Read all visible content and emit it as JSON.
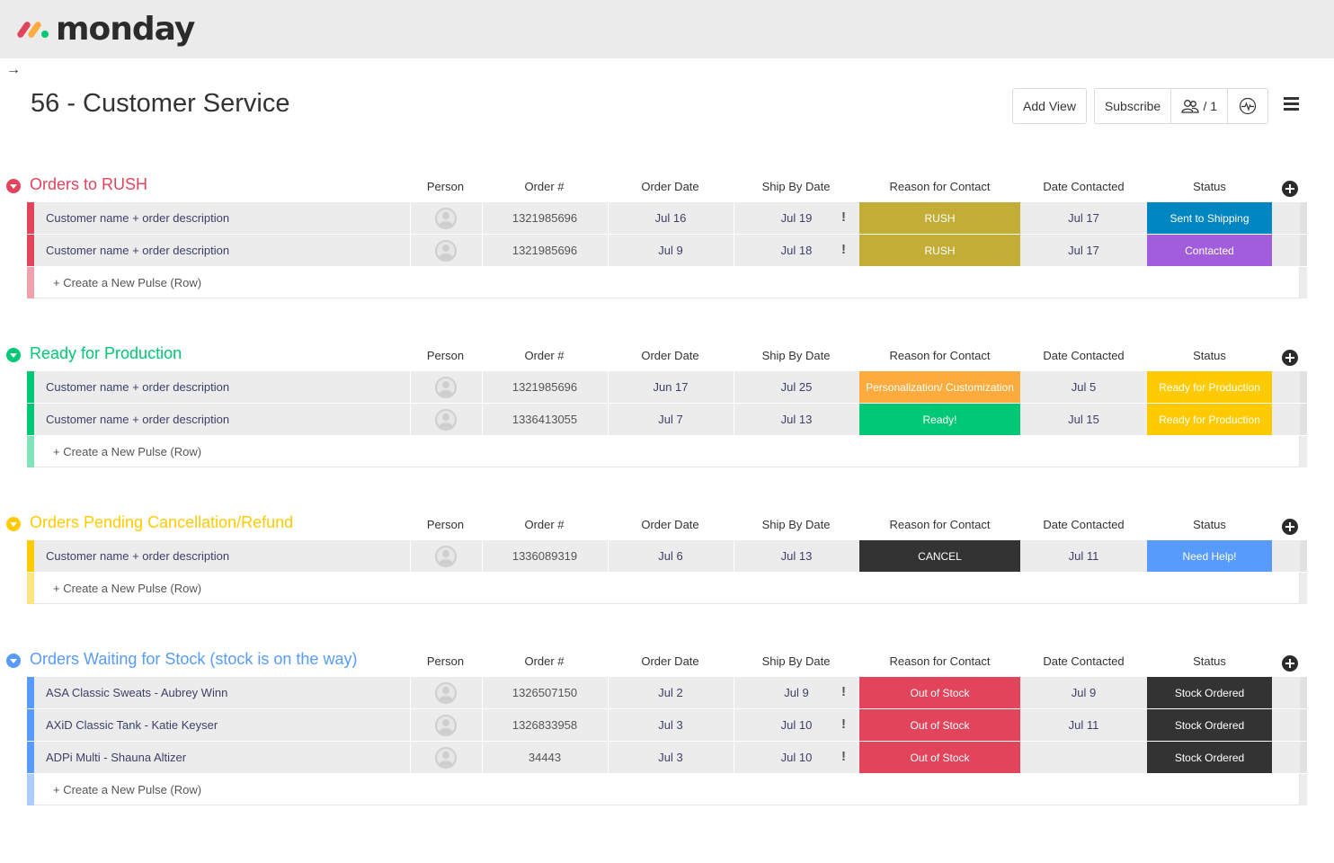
{
  "app": {
    "logo_text": "monday"
  },
  "header": {
    "back_arrow": "→",
    "title": "56 - Customer Service",
    "add_view_label": "Add View",
    "subscribe_label": "Subscribe",
    "members_count": "/ 1"
  },
  "columns": [
    "Person",
    "Order #",
    "Order Date",
    "Ship By Date",
    "Reason for Contact",
    "Date Contacted",
    "Status"
  ],
  "create_row_label": "+ Create a New Pulse (Row)",
  "groups": [
    {
      "title": "Orders to RUSH",
      "color": "#e2445c",
      "light_color": "#f0a1ad",
      "rows": [
        {
          "name": "Customer name + order description",
          "order": "1321985696",
          "order_date": "Jul 16",
          "ship_date": "Jul 19",
          "alert": "!",
          "reason": "RUSH",
          "reason_color": "#c4ad37",
          "date_contacted": "Jul 17",
          "status": "Sent to Shipping",
          "status_color": "#0086c0"
        },
        {
          "name": "Customer name + order description",
          "order": "1321985696",
          "order_date": "Jul 9",
          "ship_date": "Jul 18",
          "alert": "!",
          "reason": "RUSH",
          "reason_color": "#c4ad37",
          "date_contacted": "Jul 17",
          "status": "Contacted",
          "status_color": "#a25ddc"
        }
      ]
    },
    {
      "title": "Ready for Production",
      "color": "#00c875",
      "light_color": "#80e3ba",
      "rows": [
        {
          "name": "Customer name + order description",
          "order": "1321985696",
          "order_date": "Jun 17",
          "ship_date": "Jul 25",
          "alert": "",
          "reason": "Personalization/ Customization",
          "reason_color": "#fdab3d",
          "date_contacted": "Jul 5",
          "status": "Ready for Production",
          "status_color": "#ffcb00"
        },
        {
          "name": "Customer name + order description",
          "order": "1336413055",
          "order_date": "Jul 7",
          "ship_date": "Jul 13",
          "alert": "",
          "reason": "Ready!",
          "reason_color": "#00c875",
          "date_contacted": "Jul 15",
          "status": "Ready for Production",
          "status_color": "#ffcb00"
        }
      ]
    },
    {
      "title": "Orders Pending Cancellation/Refund",
      "color": "#ffcb00",
      "light_color": "#ffe580",
      "rows": [
        {
          "name": "Customer name + order description",
          "order": "1336089319",
          "order_date": "Jul 6",
          "ship_date": "Jul 13",
          "alert": "",
          "reason": "CANCEL",
          "reason_color": "#333333",
          "date_contacted": "Jul 11",
          "status": "Need Help!",
          "status_color": "#579bfc"
        }
      ]
    },
    {
      "title": "Orders Waiting for Stock (stock is on the way)",
      "color": "#579bfc",
      "light_color": "#abcdfd",
      "rows": [
        {
          "name": "ASA Classic Sweats - Aubrey Winn",
          "order": "1326507150",
          "order_date": "Jul 2",
          "ship_date": "Jul 9",
          "alert": "!",
          "reason": "Out of Stock",
          "reason_color": "#e2445c",
          "date_contacted": "Jul 9",
          "status": "Stock Ordered",
          "status_color": "#333333"
        },
        {
          "name": "AXiD Classic Tank - Katie Keyser",
          "order": "1326833958",
          "order_date": "Jul 3",
          "ship_date": "Jul 10",
          "alert": "!",
          "reason": "Out of Stock",
          "reason_color": "#e2445c",
          "date_contacted": "Jul 11",
          "status": "Stock Ordered",
          "status_color": "#333333"
        },
        {
          "name": "ADPi Multi - Shauna Altizer",
          "order": "34443",
          "order_date": "Jul 3",
          "ship_date": "Jul 10",
          "alert": "!",
          "reason": "Out of Stock",
          "reason_color": "#e2445c",
          "date_contacted": "",
          "status": "Stock Ordered",
          "status_color": "#333333"
        }
      ]
    }
  ]
}
